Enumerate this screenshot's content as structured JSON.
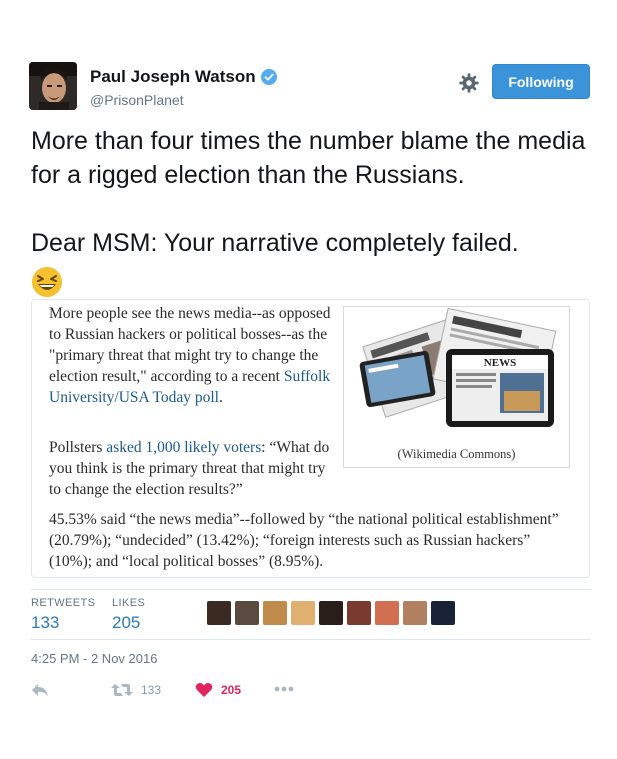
{
  "author": {
    "name": "Paul Joseph Watson",
    "handle": "@PrisonPlanet"
  },
  "follow_button_label": "Following",
  "tweet": {
    "line1": "More than four times the number blame the media for a rigged election than the Russians.",
    "line2": "Dear MSM: Your narrative completely failed."
  },
  "card": {
    "p1": "More people see the news media--as opposed to Russian hackers or political bosses--as the \"primary threat that might try to change the election result,\" according to a recent ",
    "p1_link": "Suffolk University/USA Today poll",
    "p1_end": ".",
    "p2_start": "Pollsters ",
    "p2_link": "asked 1,000 likely voters",
    "p2_rest": ": “What do you think is the primary threat that might try to change the election results?”",
    "p3": "45.53% said “the news media”--followed by “the national political establishment” (20.79%); “undecided” (13.42%); “foreign interests such as Russian hackers” (10%); and “local political bosses” (8.95%).",
    "image_caption": "(Wikimedia Commons)",
    "image_headline": "NEWS"
  },
  "stats": {
    "retweets_label": "RETWEETS",
    "retweets": "133",
    "likes_label": "LIKES",
    "likes": "205"
  },
  "likers": [
    "#3a2a22",
    "#5a4a40",
    "#c08a4a",
    "#e0b070",
    "#2a1e1a",
    "#7a3a30",
    "#d07050",
    "#b08060",
    "#1a2238"
  ],
  "timestamp": "4:25 PM - 2 Nov 2016",
  "actions": {
    "retweet_count": "133",
    "like_count": "205"
  }
}
